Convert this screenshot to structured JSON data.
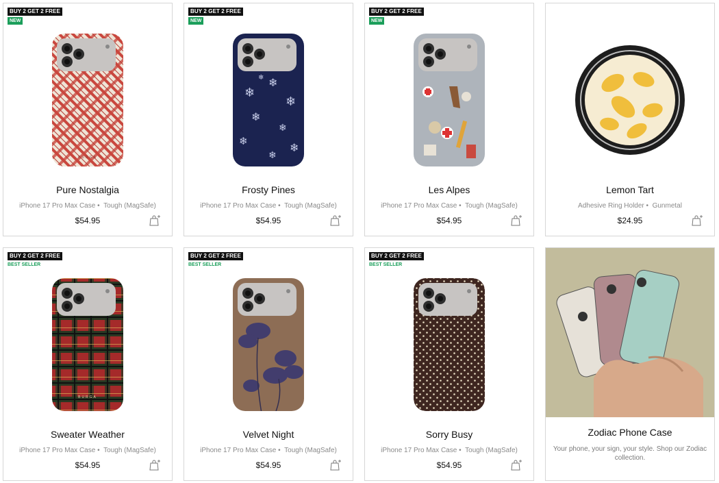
{
  "promo_badge": "BUY 2 GET 2 FREE",
  "products": [
    {
      "title": "Pure Nostalgia",
      "device": "iPhone 17 Pro Max Case",
      "variant": "Tough (MagSafe)",
      "price": "$54.95",
      "badge": "NEW",
      "pattern": "red plaid"
    },
    {
      "title": "Frosty Pines",
      "device": "iPhone 17 Pro Max Case",
      "variant": "Tough (MagSafe)",
      "price": "$54.95",
      "badge": "NEW",
      "pattern": "navy snowflakes"
    },
    {
      "title": "Les Alpes",
      "device": "iPhone 17 Pro Max Case",
      "variant": "Tough (MagSafe)",
      "price": "$54.95",
      "badge": "NEW",
      "pattern": "alpine stickers"
    },
    {
      "title": "Lemon Tart",
      "device": "Adhesive Ring Holder",
      "variant": "Gunmetal",
      "price": "$24.95",
      "badge": "",
      "pattern": "lemon ring"
    },
    {
      "title": "Sweater Weather",
      "device": "iPhone 17 Pro Max Case",
      "variant": "Tough (MagSafe)",
      "price": "$54.95",
      "badge": "BEST SELLER",
      "pattern": "tartan"
    },
    {
      "title": "Velvet Night",
      "device": "iPhone 17 Pro Max Case",
      "variant": "Tough (MagSafe)",
      "price": "$54.95",
      "badge": "BEST SELLER",
      "pattern": "navy florals"
    },
    {
      "title": "Sorry Busy",
      "device": "iPhone 17 Pro Max Case",
      "variant": "Tough (MagSafe)",
      "price": "$54.95",
      "badge": "BEST SELLER",
      "pattern": "polka dots"
    }
  ],
  "zodiac": {
    "title": "Zodiac Phone Case",
    "description": "Your phone, your sign, your style. Shop our Zodiac collection."
  },
  "case_brand_mark": "BURGA",
  "colors": {
    "new_badge": "#1b9e5a",
    "promo_badge": "#111111",
    "border": "#d6d6d6"
  }
}
